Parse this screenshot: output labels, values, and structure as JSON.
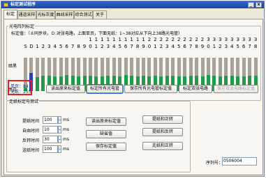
{
  "window": {
    "title": "标定测试程序",
    "minimize": "_",
    "close": "x"
  },
  "tabs": [
    "标定",
    "通道采样",
    "光标灰度",
    "曲线采样",
    "综合测试",
    "关于"
  ],
  "calibration": {
    "group_title": "光电阵列标定",
    "hint": "标定值：（８同步块，Ｄ:对张电路，上面单页，下面无纸：1~38对应从下向上38路光电管）",
    "labels": {
      "dark": "暗黑",
      "white": "亮白"
    },
    "channel_numbers_row1": [
      "S",
      "D",
      "1",
      "2",
      "3",
      "4",
      "5",
      "6",
      "7",
      "8",
      "9",
      "0",
      "1",
      "2",
      "3",
      "4",
      "5",
      "6",
      "7",
      "8",
      "9",
      "0",
      "1",
      "2",
      "3",
      "4",
      "5",
      "6",
      "7",
      "8",
      "9",
      "0",
      "1",
      "2",
      "3",
      "4",
      "5",
      "6",
      "7",
      "8"
    ],
    "channel_numbers_row0": [
      "",
      "",
      "",
      "",
      "",
      "",
      "",
      "",
      "",
      "",
      "",
      "1",
      "1",
      "1",
      "1",
      "1",
      "1",
      "1",
      "1",
      "1",
      "1",
      "2",
      "2",
      "2",
      "2",
      "2",
      "2",
      "2",
      "2",
      "2",
      "2",
      "3",
      "3",
      "3",
      "3",
      "3",
      "3",
      "3",
      "3",
      "3"
    ],
    "channel_levels": [
      0.1,
      0.55,
      0.42,
      0.45,
      0.46,
      0.44,
      0.43,
      0.47,
      0.45,
      0.44,
      0.46,
      0.45,
      0.43,
      0.44,
      0.46,
      0.45,
      0.44,
      0.47,
      0.45,
      0.44,
      0.46,
      0.43,
      0.45,
      0.44,
      0.46,
      0.45,
      0.44,
      0.43,
      0.46,
      0.45,
      0.44,
      0.47,
      0.45,
      0.44,
      0.46,
      0.45,
      0.43,
      0.44,
      0.45,
      0.46
    ],
    "highlight_channel": 1,
    "status": {
      "single": "单页：84",
      "nopaper": "无纸：255"
    },
    "buttons": [
      "读出原来标定值",
      "标定所有光电管",
      "保存所有光电管标定值",
      "标定双张电路",
      "保存双张电路标定值"
    ]
  },
  "walk": {
    "group_title": "走纸标定与测试",
    "fields": [
      {
        "label": "提纸时间",
        "value": "100",
        "unit": "ms"
      },
      {
        "label": "自由时间",
        "value": "10",
        "unit": "ms"
      },
      {
        "label": "反转时间",
        "value": "30",
        "unit": "ms"
      },
      {
        "label": "送纸时间",
        "value": "100",
        "unit": "ms"
      }
    ],
    "mid_buttons": [
      "读出原来标定值",
      "缺省值",
      "保存标定值"
    ],
    "right_buttons": [
      "提纸和正转",
      "提纸和反转",
      "走纸和正转"
    ],
    "serial_label": "序列号：",
    "serial_value": "0506004"
  }
}
